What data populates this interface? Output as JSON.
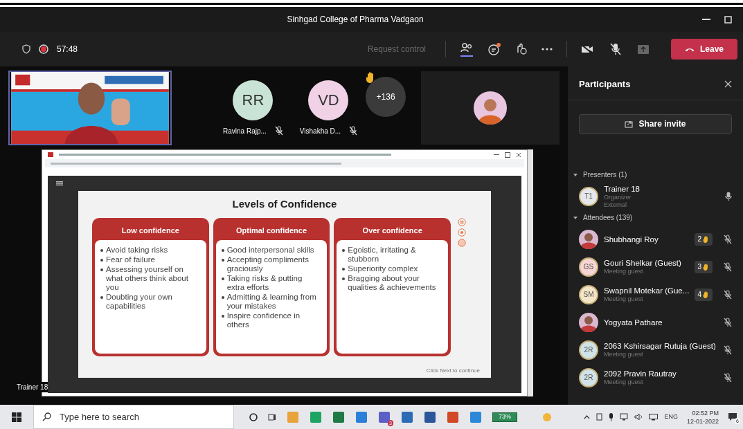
{
  "window": {
    "title": "Sinhgad College of Pharma Vadgaon"
  },
  "toolbar": {
    "timer": "57:48",
    "request_control": "Request control",
    "leave": "Leave"
  },
  "stage": {
    "tiles": [
      {
        "initials": "RR",
        "name": "Ravina Rajp...",
        "muted": true,
        "color": "#c9e4d6"
      },
      {
        "initials": "VD",
        "name": "Vishakha D...",
        "muted": true,
        "color": "#f1d1e6"
      }
    ],
    "overflow": "+136",
    "presenter_label": "Trainer 18"
  },
  "slide": {
    "title": "Levels of Confidence",
    "footer": "Click Next to continue",
    "columns": [
      {
        "heading": "Low confidence",
        "items": [
          "Avoid taking risks",
          "Fear of failure",
          "Assessing yourself on what others think about you",
          "Doubting your own capabilities"
        ]
      },
      {
        "heading": "Optimal confidence",
        "items": [
          "Good interpersonal skills",
          "Accepting compliments graciously",
          "Taking risks & putting extra efforts",
          "Admitting & learning from your mistakes",
          "Inspire confidence in others"
        ]
      },
      {
        "heading": "Over confidence",
        "items": [
          "Egoistic, irritating & stubborn",
          "Superiority complex",
          "Bragging about your qualities & achievements"
        ]
      }
    ]
  },
  "participants": {
    "title": "Participants",
    "share_invite": "Share invite",
    "sections": [
      {
        "label": "Presenters (1)",
        "people": [
          {
            "name": "Trainer 18",
            "kind": "initials",
            "initials": "T1",
            "color": "#e5e7eb",
            "details": [
              "Organizer",
              "External"
            ],
            "muted": false
          }
        ]
      },
      {
        "label": "Attendees (139)",
        "people": [
          {
            "name": "Shubhangi Roy",
            "hands": "2",
            "muted": true
          },
          {
            "name": "Gouri Shelkar (Guest)",
            "kind": "initials",
            "initials": "GS",
            "color": "#f6d5d5",
            "details": [
              "Meeting guest"
            ],
            "hands": "3",
            "muted": true
          },
          {
            "name": "Swapnil Motekar (Gue...",
            "kind": "initials",
            "initials": "SM",
            "color": "#f3e6c8",
            "details": [
              "Meeting guest"
            ],
            "hands": "4",
            "muted": true
          },
          {
            "name": "Yogyata Pathare",
            "muted": true
          },
          {
            "name": "2063 Kshirsagar Rutuja (Guest)",
            "kind": "initials",
            "initials": "2R",
            "color": "#cfe3e8",
            "details": [
              "Meeting guest"
            ],
            "muted": true
          },
          {
            "name": "2092 Pravin Rautray",
            "kind": "initials",
            "initials": "2R",
            "color": "#cfe3e8",
            "details": [
              "Meeting guest"
            ],
            "muted": true
          }
        ]
      }
    ]
  },
  "taskbar": {
    "search_placeholder": "Type here to search",
    "teams_badge": "3",
    "battery": "73%",
    "language": "ENG",
    "time": "02:52 PM",
    "date": "12-01-2022",
    "notifications": "6"
  }
}
